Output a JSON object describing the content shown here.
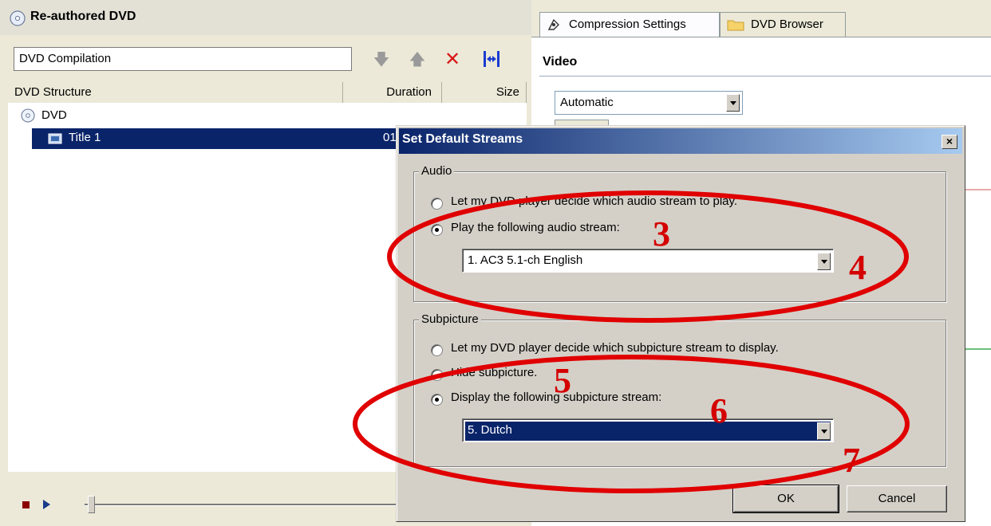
{
  "left_panel": {
    "title": "Re-authored DVD",
    "compilation_name": "DVD Compilation",
    "columns": {
      "structure": "DVD Structure",
      "duration": "Duration",
      "size": "Size"
    },
    "tree": {
      "root_label": "DVD",
      "title_label": "Title 1",
      "title_duration": "01:"
    },
    "icons": {
      "move_down": "down-arrow-icon",
      "move_up": "up-arrow-icon",
      "delete": "delete-x-icon",
      "fit": "fit-to-disc-icon"
    }
  },
  "right_panel": {
    "tabs": [
      {
        "label": "Compression Settings"
      },
      {
        "label": "DVD Browser"
      }
    ],
    "section_title": "Video",
    "video_mode": "Automatic"
  },
  "dialog": {
    "title": "Set Default Streams",
    "close_label": "×",
    "audio": {
      "group_label": "Audio",
      "option_let_player": "Let my DVD player decide which audio stream to play.",
      "option_play_stream": "Play the following audio stream:",
      "selected_option": "play_stream",
      "stream_value": "1. AC3 5.1-ch English"
    },
    "subpicture": {
      "group_label": "Subpicture",
      "option_let_player": "Let my DVD player decide which subpicture stream to display.",
      "option_hide": "Hide subpicture.",
      "option_display_stream": "Display the following subpicture stream:",
      "selected_option": "display_stream",
      "stream_value": "5. Dutch"
    },
    "ok_label": "OK",
    "cancel_label": "Cancel"
  },
  "annotations": {
    "color": "#e00000",
    "numbers": [
      "3",
      "4",
      "5",
      "6",
      "7"
    ]
  },
  "colors": {
    "selection": "#0a246a",
    "dialog_title_start": "#0a246a",
    "dialog_title_end": "#a6caf0",
    "annotation_red": "#e00000"
  }
}
